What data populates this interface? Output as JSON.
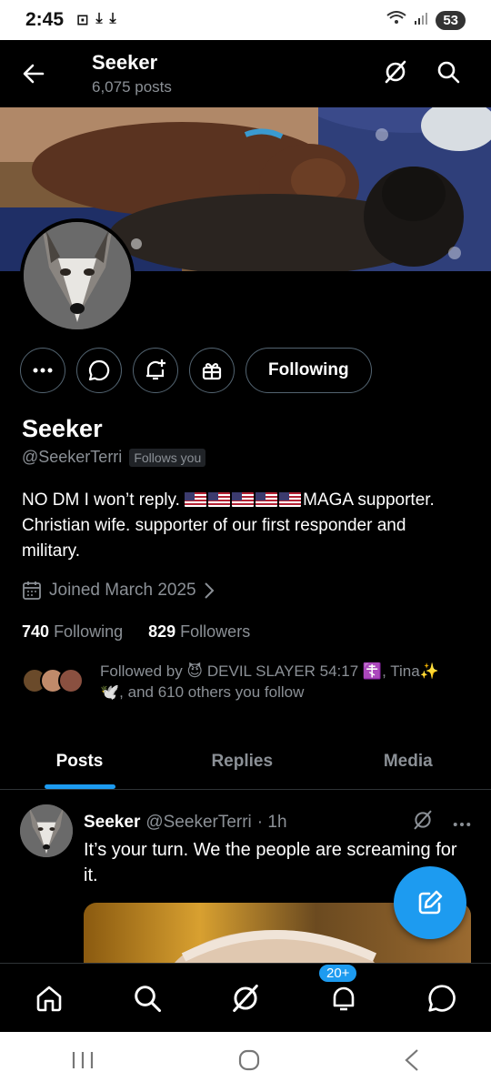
{
  "status_bar": {
    "time": "2:45",
    "battery": "53"
  },
  "header": {
    "title": "Seeker",
    "post_count": "6,075 posts"
  },
  "profile": {
    "name": "Seeker",
    "handle": "@SeekerTerri",
    "follows_you_badge": "Follows you",
    "bio_suffix": "MAGA",
    "bio_rest": "supporter. Christian wife. supporter of our first responder and military.",
    "bio_prefix": "NO DM I won’t reply.",
    "joined": "Joined March 2025",
    "following_count": "740",
    "following_label": "Following",
    "followers_count": "829",
    "followers_label": "Followers",
    "followed_by_line1": "Followed by 😈 DEVIL SLAYER 54:17 ☦️, Tina✨",
    "followed_by_line2": "🕊️, and 610 others you follow",
    "following_button": "Following"
  },
  "tabs": [
    {
      "label": "Posts",
      "active": true
    },
    {
      "label": "Replies",
      "active": false
    },
    {
      "label": "Media",
      "active": false
    }
  ],
  "post": {
    "name": "Seeker",
    "handle": "@SeekerTerri",
    "time": "· 1h",
    "text": "It’s your turn. We the people are screaming for it."
  },
  "bottom_nav": {
    "notifications_badge": "20+"
  },
  "colors": {
    "accent": "#1d9bf0",
    "background": "#000000",
    "muted": "#8b9096"
  }
}
